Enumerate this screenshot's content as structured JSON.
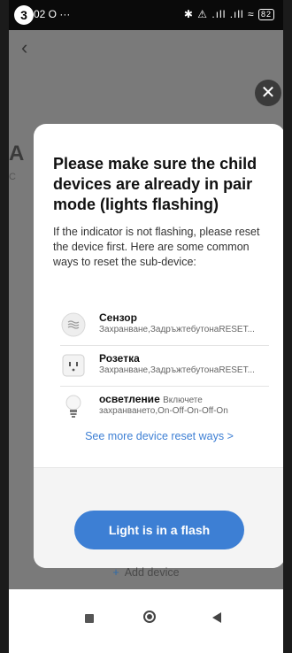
{
  "status_bar": {
    "step_badge": "3",
    "time": "02 O ···",
    "icons": "✱ ⚠ .ıll .ıll ≈",
    "battery": "82"
  },
  "background": {
    "back_icon": "‹",
    "heading_fragment": "A",
    "subtitle_fragment": "C",
    "overflow_fragment": "..",
    "close_icon": "✕",
    "add_device_label": "Add device",
    "add_device_icon": "+"
  },
  "modal": {
    "title": "Please make sure the child devices are already in pair mode (lights flashing)",
    "description": "If the indicator is not flashing, please reset the device first. Here are some common ways to reset the sub-device:",
    "devices": [
      {
        "name": "Сензор",
        "inline_note": "",
        "subtitle": "Захранване,ЗадръжтебутонаRESET...",
        "icon": "sensor-icon"
      },
      {
        "name": "Розетка",
        "inline_note": "",
        "subtitle": "Захранване,ЗадръжтебутонаRESET...",
        "icon": "socket-icon"
      },
      {
        "name": "осветление",
        "inline_note": "Включете",
        "subtitle": "захранването,On-Off-On-Off-On",
        "icon": "light-bulb-icon"
      }
    ],
    "see_more_label": "See more device reset ways >",
    "confirm_label": "Light is in a flash"
  },
  "colors": {
    "accent": "#3d7fd4",
    "overlay": "#7a7a7a"
  }
}
